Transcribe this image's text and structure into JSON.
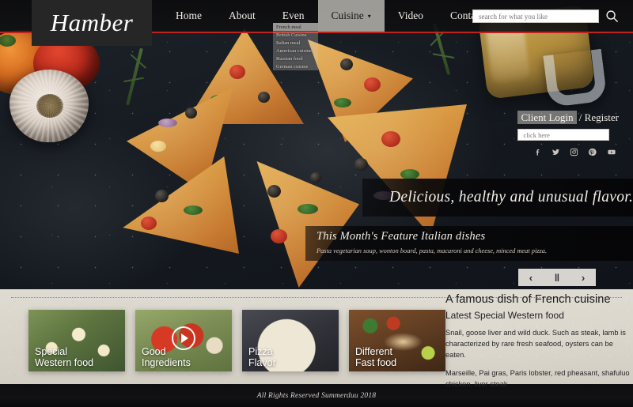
{
  "brand": {
    "logo": "Hamber"
  },
  "nav": {
    "items": [
      {
        "label": "Home",
        "active": false
      },
      {
        "label": "About",
        "active": false
      },
      {
        "label": "Even",
        "active": false
      },
      {
        "label": "Cuisine",
        "active": true,
        "caret": "▾"
      },
      {
        "label": "Video",
        "active": false
      },
      {
        "label": "Contact",
        "active": false
      }
    ],
    "dropdown": [
      {
        "label": "French meal",
        "highlight": true
      },
      {
        "label": "British Cuisine",
        "highlight": false
      },
      {
        "label": "Italian meal",
        "highlight": false
      },
      {
        "label": "American cuisine",
        "highlight": false
      },
      {
        "label": "Russian food",
        "highlight": false
      },
      {
        "label": "German cuisine",
        "highlight": false
      }
    ]
  },
  "search": {
    "placeholder": "search for what you like",
    "icon": "search-icon"
  },
  "login": {
    "primary": "Client Login",
    "separator": " / ",
    "secondary": "Register",
    "input_placeholder": "click here",
    "socials": [
      "facebook-icon",
      "twitter-icon",
      "instagram-icon",
      "pinterest-icon",
      "youtube-icon"
    ]
  },
  "hero": {
    "tagline": "Delicious, healthy and unusual flavor.",
    "feature_title": "This Month's  Feature Italian dishes",
    "feature_subtitle": "Pasta vegetarian soup, wonton board, pasta, macaroni and cheese, minced meat pizza."
  },
  "carousel": {
    "prev": "‹",
    "pause": "‖",
    "next": "›"
  },
  "cards": [
    {
      "label_line1": "Special",
      "label_line2": "Western food",
      "art": "art-avocado",
      "play": false
    },
    {
      "label_line1": "Good",
      "label_line2": "Ingredients",
      "art": "art-tomato",
      "play": true
    },
    {
      "label_line1": "Pizza",
      "label_line2": "Flavor",
      "art": "art-pizza",
      "play": false
    },
    {
      "label_line1": "Different",
      "label_line2": "Fast food",
      "art": "art-wrap",
      "play": false
    }
  ],
  "info": {
    "heading": "A famous dish of French cuisine",
    "subheading": "Latest  Special Western food",
    "paragraph1": "Snail, goose liver and wild duck. Such as steak, lamb is characterized by rare fresh seafood, oysters can be eaten.",
    "paragraph2": "Marseille, Pai gras, Paris lobster, red pheasant, shafuluo chicken, liver steak"
  },
  "footer": {
    "text": "All Rights Reserved  Summerduu 2018"
  },
  "colors": {
    "accent_red": "#c0231f",
    "header_dark": "#262626",
    "lower_bg": "#d9d5cb"
  }
}
